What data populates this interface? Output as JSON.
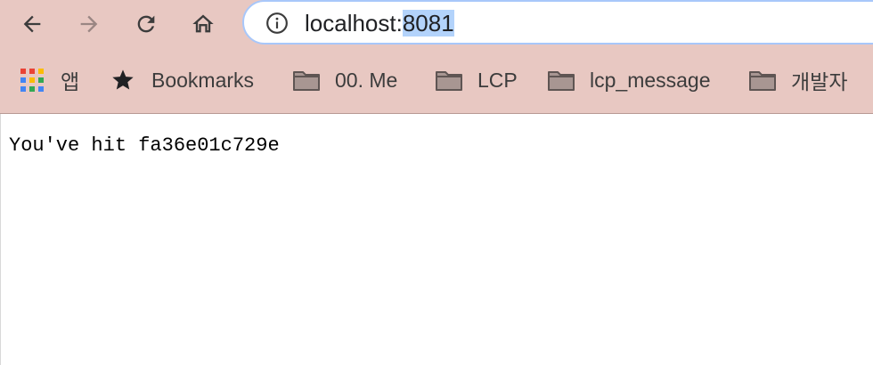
{
  "toolbar": {
    "back_icon": "arrow-left-icon",
    "forward_icon": "arrow-right-icon",
    "reload_icon": "reload-icon",
    "home_icon": "home-icon"
  },
  "address_bar": {
    "host": "localhost:",
    "port": "8081",
    "info_icon": "info-icon"
  },
  "bookmarks_bar": {
    "items": [
      {
        "label": "앱",
        "icon": "apps-grid-icon"
      },
      {
        "label": "Bookmarks",
        "icon": "star-icon"
      },
      {
        "label": "00. Me",
        "icon": "folder-icon"
      },
      {
        "label": "LCP",
        "icon": "folder-icon"
      },
      {
        "label": "lcp_message",
        "icon": "folder-icon"
      },
      {
        "label": "개발자",
        "icon": "folder-icon"
      }
    ]
  },
  "page": {
    "body_text": "You've hit fa36e01c729e"
  },
  "colors": {
    "chrome_bg": "#e8c8c2",
    "selection_highlight": "#b3d3fb",
    "omnibox_border": "#a8c7fa"
  }
}
